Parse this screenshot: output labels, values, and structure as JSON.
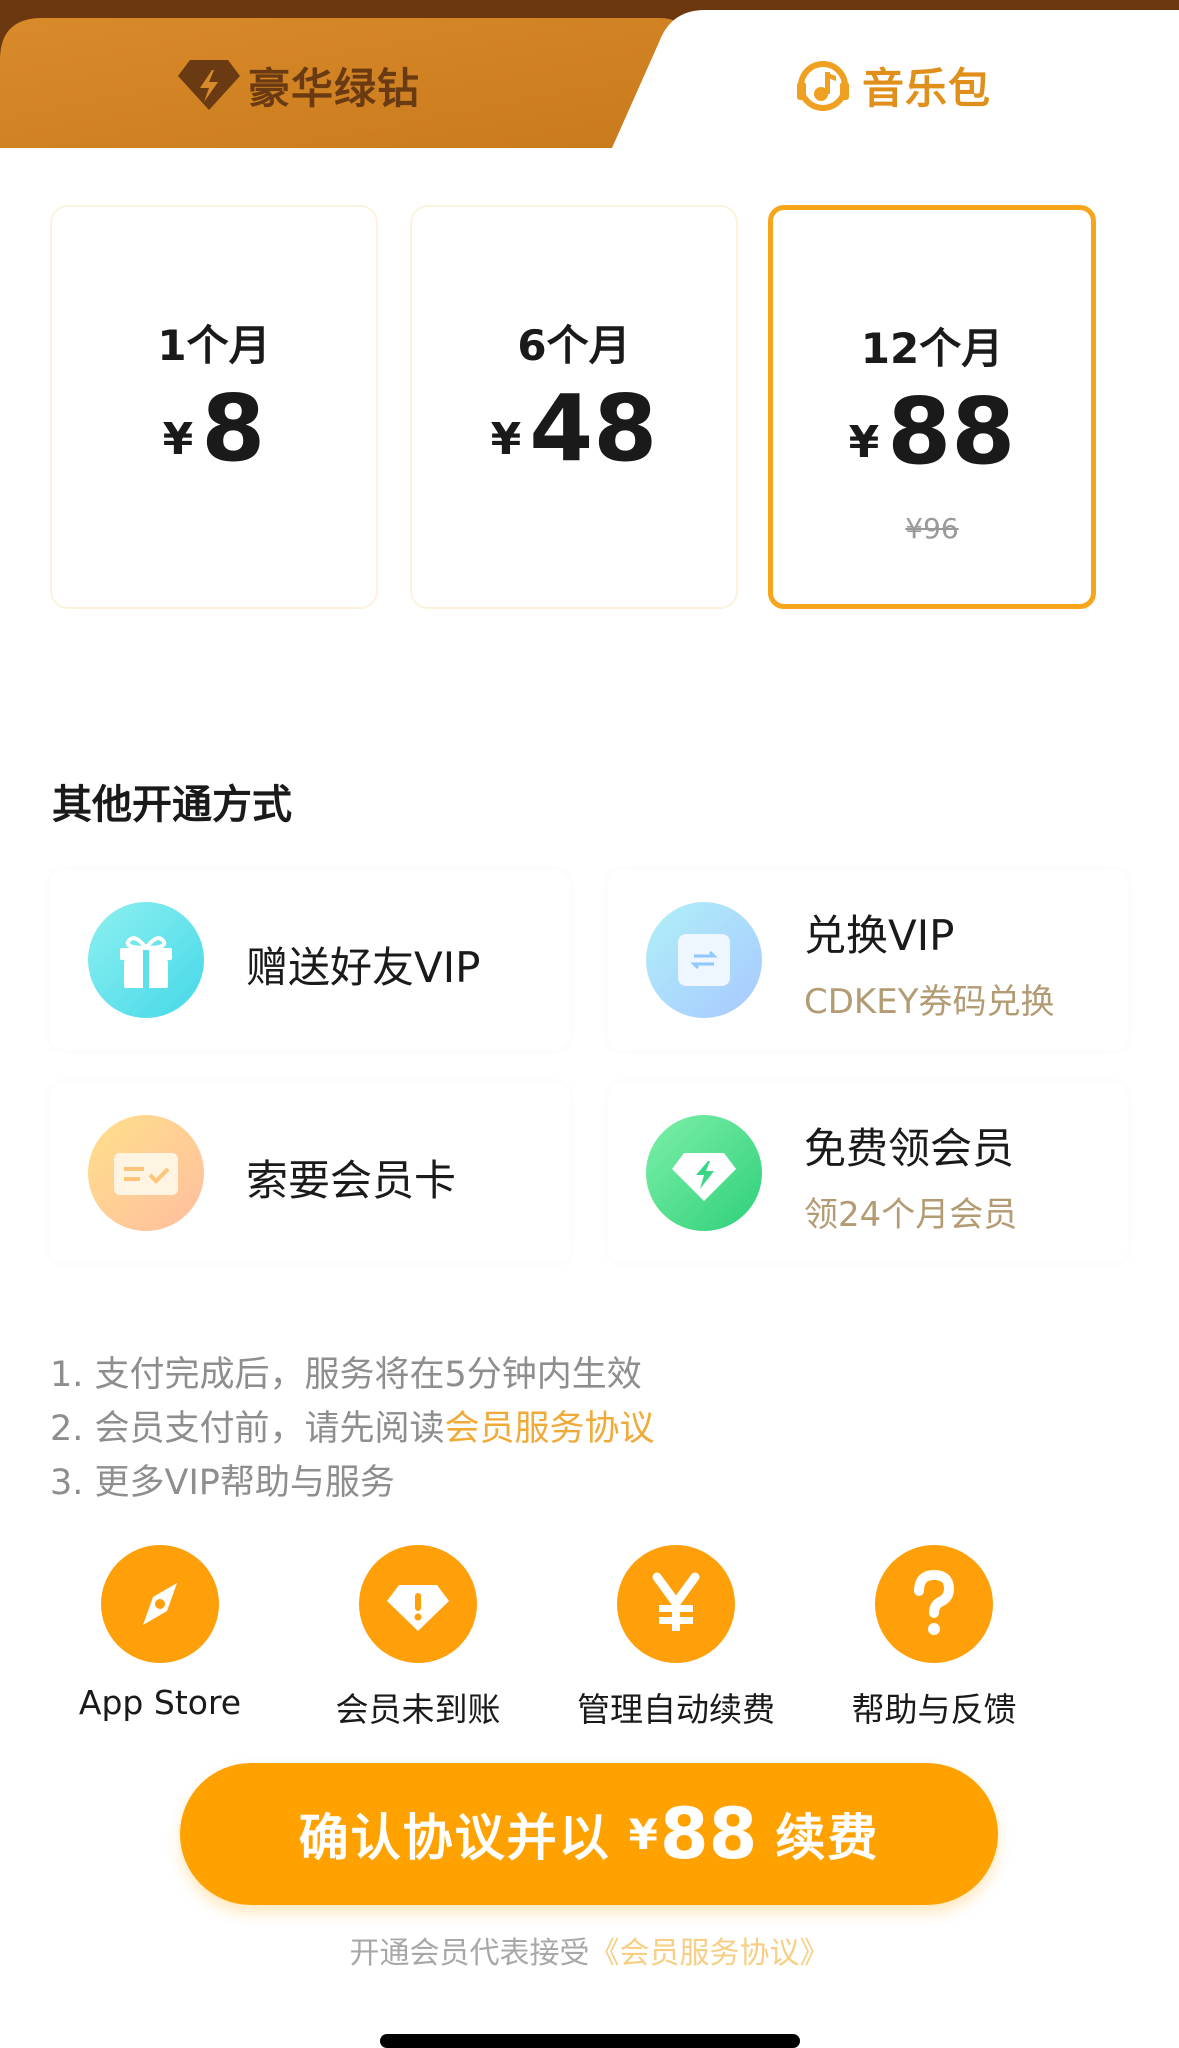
{
  "tabs": [
    {
      "label": "豪华绿钻",
      "icon": "diamond-bolt-icon",
      "active": false
    },
    {
      "label": "音乐包",
      "icon": "music-note-icon",
      "active": true
    }
  ],
  "plans": [
    {
      "duration": "1个月",
      "currency": "¥",
      "price": "8",
      "original": "",
      "selected": false
    },
    {
      "duration": "6个月",
      "currency": "¥",
      "price": "48",
      "original": "",
      "selected": false
    },
    {
      "duration": "12个月",
      "currency": "¥",
      "price": "88",
      "original": "¥96",
      "selected": true
    }
  ],
  "other_methods": {
    "title": "其他开通方式",
    "items": [
      {
        "title": "赠送好友VIP",
        "subtitle": "",
        "icon": "gift-icon"
      },
      {
        "title": "兑换VIP",
        "subtitle": "CDKEY券码兑换",
        "icon": "exchange-icon"
      },
      {
        "title": "索要会员卡",
        "subtitle": "",
        "icon": "card-icon"
      },
      {
        "title": "免费领会员",
        "subtitle": "领24个月会员",
        "icon": "diamond-icon"
      }
    ]
  },
  "notes": {
    "line1": "1. 支付完成后，服务将在5分钟内生效",
    "line2_prefix": "2. 会员支付前，请先阅读",
    "line2_link": "会员服务协议",
    "line3": "3. 更多VIP帮助与服务"
  },
  "actions": [
    {
      "label": "App Store",
      "icon": "compass-icon"
    },
    {
      "label": "会员未到账",
      "icon": "alert-diamond-icon"
    },
    {
      "label": "管理自动续费",
      "icon": "yen-icon"
    },
    {
      "label": "帮助与反馈",
      "icon": "question-icon"
    }
  ],
  "confirm": {
    "prefix": "确认协议并以",
    "currency": "¥",
    "amount": "88",
    "suffix": "续费"
  },
  "agreement": {
    "text": "开通会员代表接受",
    "link": "《会员服务协议》"
  },
  "colors": {
    "accent": "#ffa200",
    "tab_bar": "#d98a2a",
    "selected_border": "#f7a51a",
    "link": "#f0aa38"
  }
}
